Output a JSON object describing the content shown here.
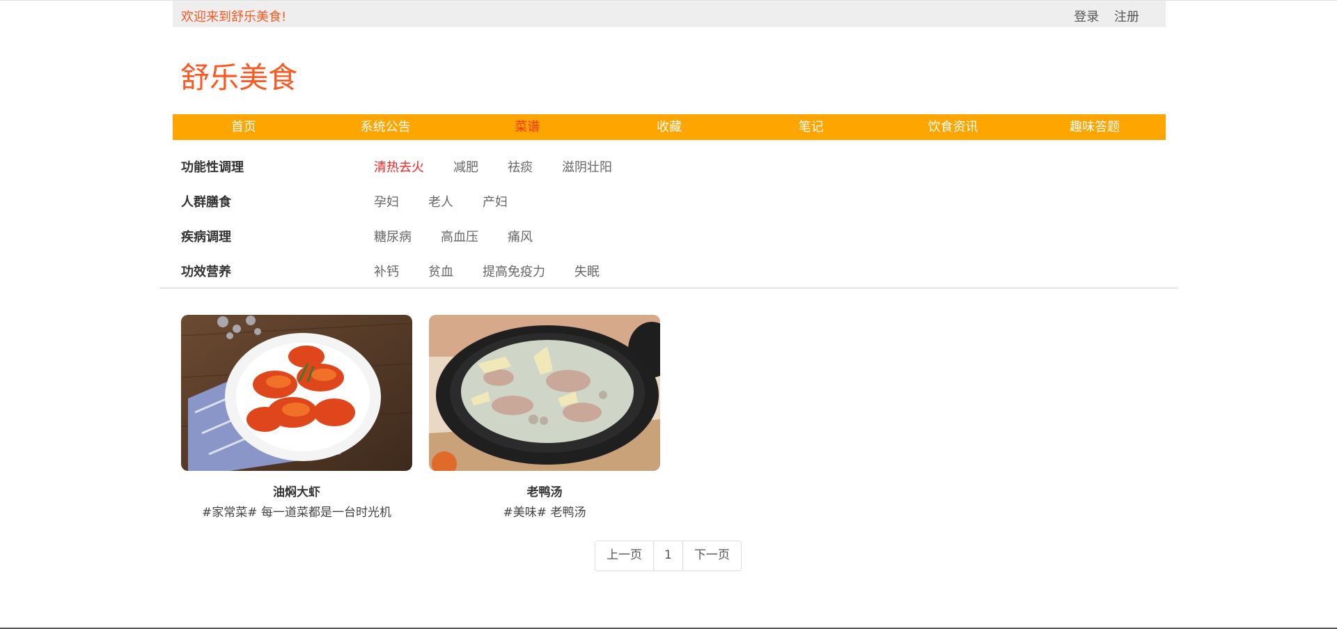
{
  "topbar": {
    "welcome": "欢迎来到舒乐美食!",
    "login": "登录",
    "register": "注册"
  },
  "site_title": "舒乐美食",
  "nav": {
    "items": [
      {
        "label": "首页",
        "active": false
      },
      {
        "label": "系统公告",
        "active": false
      },
      {
        "label": "菜谱",
        "active": true
      },
      {
        "label": "收藏",
        "active": false
      },
      {
        "label": "笔记",
        "active": false
      },
      {
        "label": "饮食资讯",
        "active": false
      },
      {
        "label": "趣味答题",
        "active": false
      }
    ]
  },
  "filters": [
    {
      "category": "功能性调理",
      "tags": [
        "清热去火",
        "减肥",
        "祛痰",
        "滋阴壮阳"
      ],
      "active_tag": "清热去火"
    },
    {
      "category": "人群膳食",
      "tags": [
        "孕妇",
        "老人",
        "产妇"
      ],
      "active_tag": ""
    },
    {
      "category": "疾病调理",
      "tags": [
        "糖尿病",
        "高血压",
        "痛风"
      ],
      "active_tag": ""
    },
    {
      "category": "功效营养",
      "tags": [
        "补钙",
        "贫血",
        "提高免疫力",
        "失眠"
      ],
      "active_tag": ""
    }
  ],
  "recipes": [
    {
      "title": "油焖大虾",
      "desc": "#家常菜# 每一道菜都是一台时光机",
      "image": "braised-shrimp-photo"
    },
    {
      "title": "老鸭汤",
      "desc": "#美味# 老鸭汤",
      "image": "duck-soup-photo"
    }
  ],
  "pagination": {
    "prev": "上一页",
    "page": "1",
    "next": "下一页"
  },
  "colors": {
    "accent": "#ff5722",
    "nav_bg": "#ffa500",
    "nav_active": "#ff3300",
    "tag_active": "#ff2222"
  }
}
